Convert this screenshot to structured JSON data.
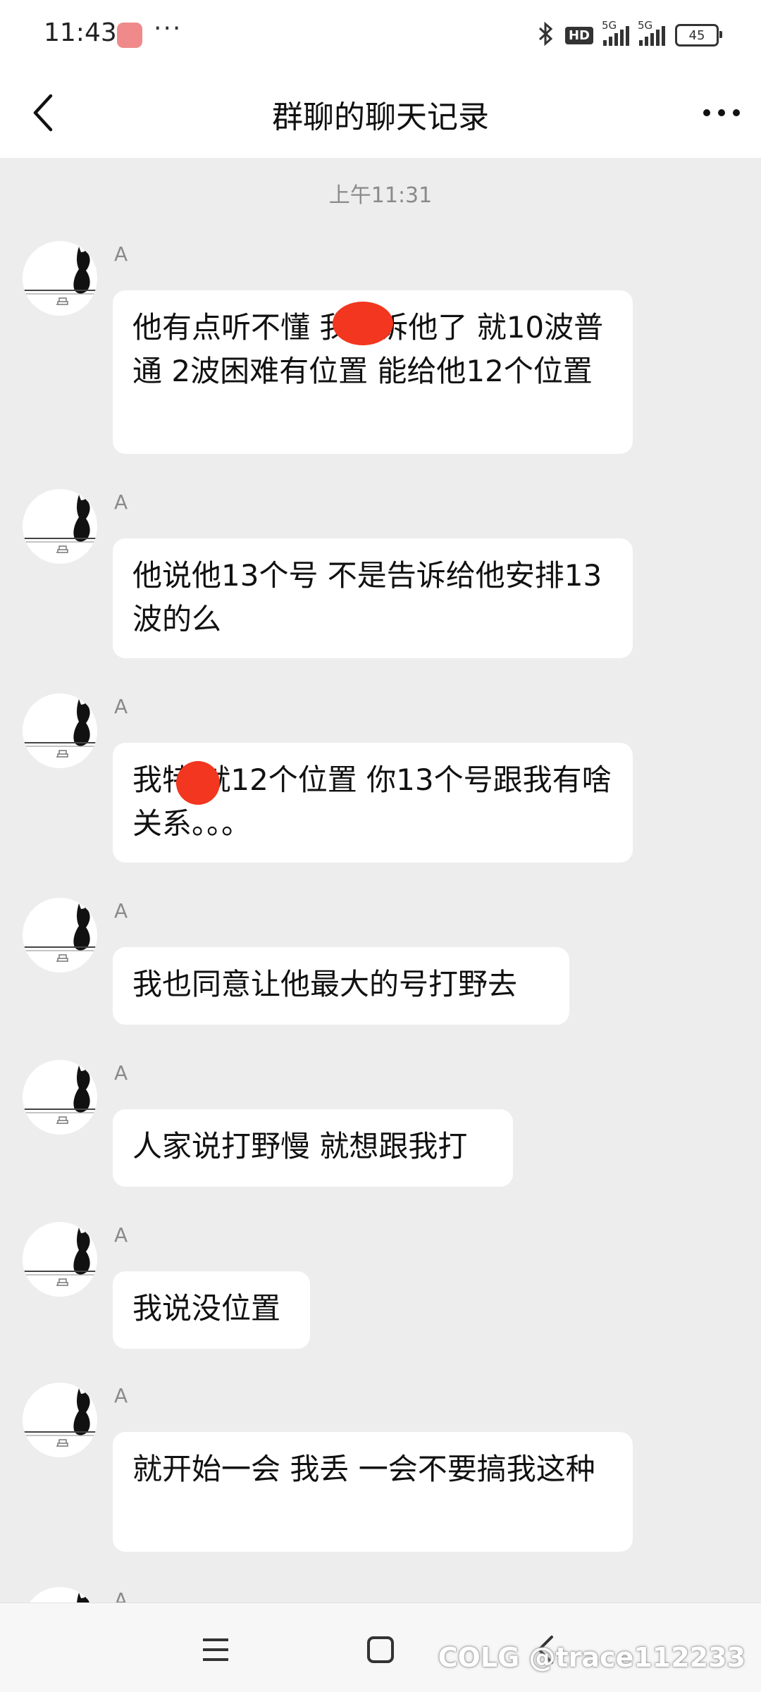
{
  "status_bar": {
    "time": "11:43",
    "dots": "···",
    "hd_label": "HD",
    "net1": "5G",
    "net2": "5G",
    "battery": "45"
  },
  "header": {
    "title": "群聊的聊天记录"
  },
  "chat": {
    "timestamp": "上午11:31",
    "messages": [
      {
        "sender": "A",
        "text": "他有点听不懂      我告诉他了 就10波普通 2波困难有位置 能给他12个位置"
      },
      {
        "sender": "A",
        "text": "他说他13个号 不是告诉给他安排13波的么"
      },
      {
        "sender": "A",
        "text": "我特   就12个位置 你13个号跟我有啥关系。。。"
      },
      {
        "sender": "A",
        "text": "我也同意让他最大的号打野去"
      },
      {
        "sender": "A",
        "text": "人家说打野慢 就想跟我打"
      },
      {
        "sender": "A",
        "text": "我说没位置"
      },
      {
        "sender": "A",
        "text": "就开始一会 我丢 一会不要搞我这种"
      },
      {
        "sender": "A",
        "text": ""
      }
    ]
  },
  "watermark": "COLG @trace112233",
  "colors": {
    "background": "#ededed",
    "bubble": "#ffffff",
    "redaction": "#f2361f"
  }
}
